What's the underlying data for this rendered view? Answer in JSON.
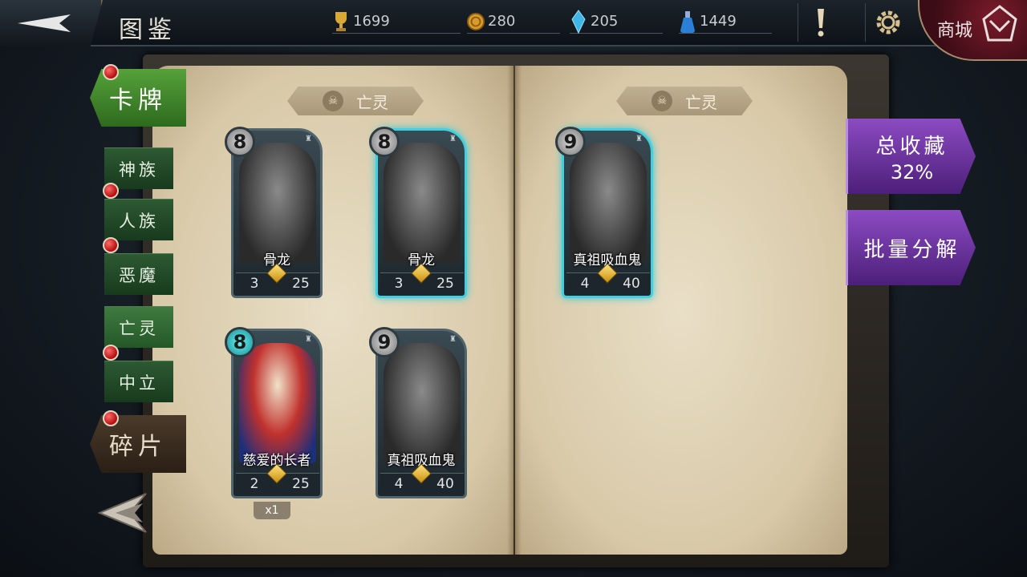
{
  "header": {
    "title": "图鉴",
    "resources": [
      {
        "icon": "trophy-icon",
        "value": "1699"
      },
      {
        "icon": "gold-coin-icon",
        "value": "280"
      },
      {
        "icon": "crystal-icon",
        "value": "205"
      },
      {
        "icon": "potion-icon",
        "value": "1449"
      }
    ],
    "shop_label": "商城"
  },
  "tabs": {
    "cards_label": "卡牌",
    "fragments_label": "碎片",
    "factions": [
      "神族",
      "人族",
      "恶魔",
      "亡灵",
      "中立"
    ],
    "active_faction": "亡灵"
  },
  "book": {
    "left_header": "亡灵",
    "right_header": "亡灵"
  },
  "cards": [
    {
      "name": "骨龙",
      "cost": "8",
      "attack": "3",
      "health": "25",
      "glow": false,
      "color": false
    },
    {
      "name": "骨龙",
      "cost": "8",
      "attack": "3",
      "health": "25",
      "glow": true,
      "color": false
    },
    {
      "name": "真祖吸血鬼",
      "cost": "9",
      "attack": "4",
      "health": "40",
      "glow": true,
      "color": false
    },
    {
      "name": "慈爱的长者",
      "cost": "8",
      "attack": "2",
      "health": "25",
      "glow": false,
      "color": true,
      "count": "x1"
    },
    {
      "name": "真祖吸血鬼",
      "cost": "9",
      "attack": "4",
      "health": "40",
      "glow": false,
      "color": false
    }
  ],
  "side_buttons": {
    "collection_label": "总收藏",
    "collection_percent": "32%",
    "bulk_decompose_label": "批量分解"
  }
}
